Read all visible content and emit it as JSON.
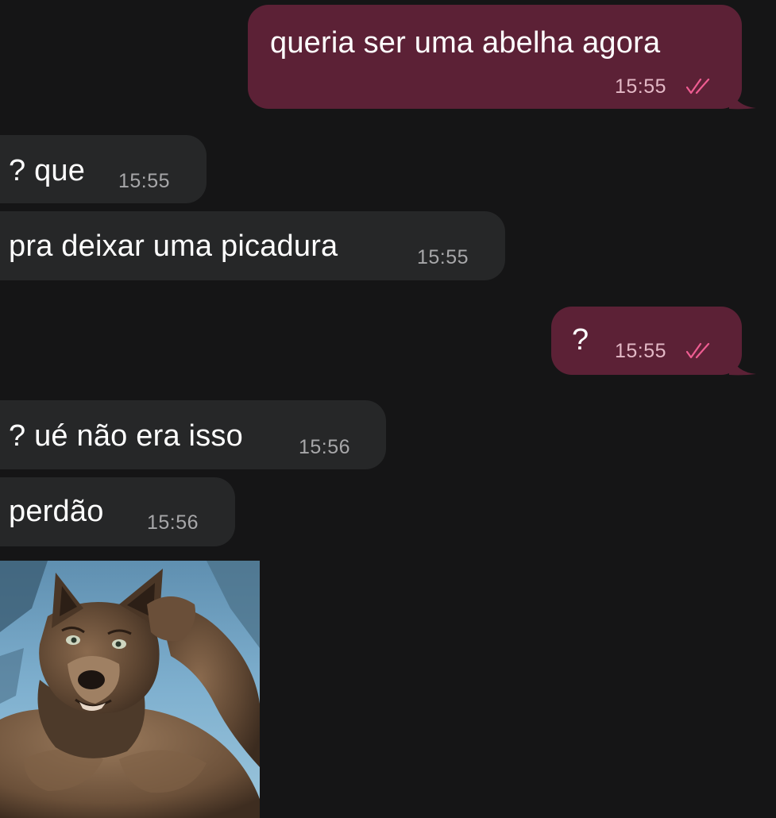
{
  "messages": [
    {
      "direction": "outgoing",
      "text": "queria ser uma abelha agora",
      "time": "15:55",
      "status": "read-double-check"
    },
    {
      "direction": "incoming",
      "text": "? que",
      "time": "15:55"
    },
    {
      "direction": "incoming",
      "text": "pra deixar uma picadura",
      "time": "15:55"
    },
    {
      "direction": "outgoing",
      "text": "?",
      "time": "15:55",
      "status": "read-double-check"
    },
    {
      "direction": "incoming",
      "text": "? ué não era isso",
      "time": "15:56"
    },
    {
      "direction": "incoming",
      "text": "perdão",
      "time": "15:56"
    },
    {
      "direction": "incoming",
      "type": "image",
      "image_icon": "werewolf-photo"
    }
  ],
  "colors": {
    "background": "#151516",
    "outgoing_bubble": "#5c2136",
    "incoming_bubble": "#262728",
    "read_ticks": "#ef5d92"
  }
}
